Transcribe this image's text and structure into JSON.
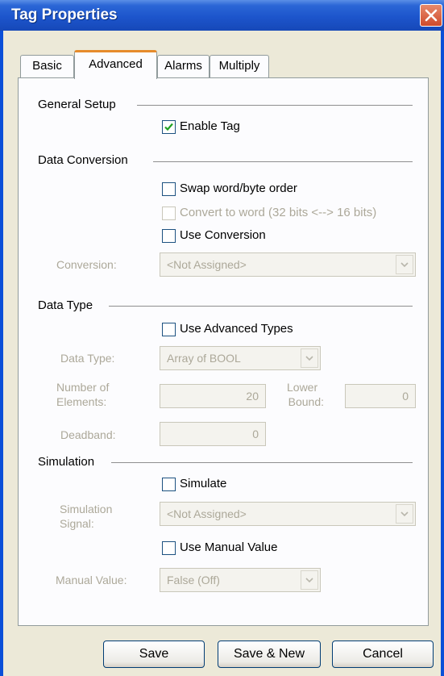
{
  "window": {
    "title": "Tag Properties"
  },
  "tabs": [
    "Basic",
    "Advanced",
    "Alarms",
    "Multiply"
  ],
  "general_setup": {
    "heading": "General Setup",
    "enable_tag": {
      "label": "Enable Tag",
      "checked": true
    }
  },
  "data_conversion": {
    "heading": "Data Conversion",
    "swap": {
      "label": "Swap word/byte order",
      "checked": false
    },
    "convert": {
      "label": "Convert to word (32 bits <--> 16 bits)",
      "checked": false,
      "disabled": true
    },
    "use_conversion": {
      "label": "Use Conversion",
      "checked": false
    },
    "conversion_label": "Conversion:",
    "conversion_value": "<Not Assigned>"
  },
  "data_type": {
    "heading": "Data Type",
    "use_advanced": {
      "label": "Use Advanced Types",
      "checked": false
    },
    "type_label": "Data Type:",
    "type_value": "Array of BOOL",
    "elements_label_1": "Number of",
    "elements_label_2": "Elements:",
    "elements_value": "20",
    "lower_label_1": "Lower",
    "lower_label_2": "Bound:",
    "lower_value": "0",
    "deadband_label": "Deadband:",
    "deadband_value": "0"
  },
  "simulation": {
    "heading": "Simulation",
    "simulate": {
      "label": "Simulate",
      "checked": false
    },
    "signal_label_1": "Simulation",
    "signal_label_2": "Signal:",
    "signal_value": "<Not Assigned>",
    "manual": {
      "label": "Use Manual Value",
      "checked": false
    },
    "manual_label": "Manual Value:",
    "manual_value": "False (Off)"
  },
  "buttons": {
    "save": "Save",
    "save_new": "Save & New",
    "cancel": "Cancel"
  }
}
